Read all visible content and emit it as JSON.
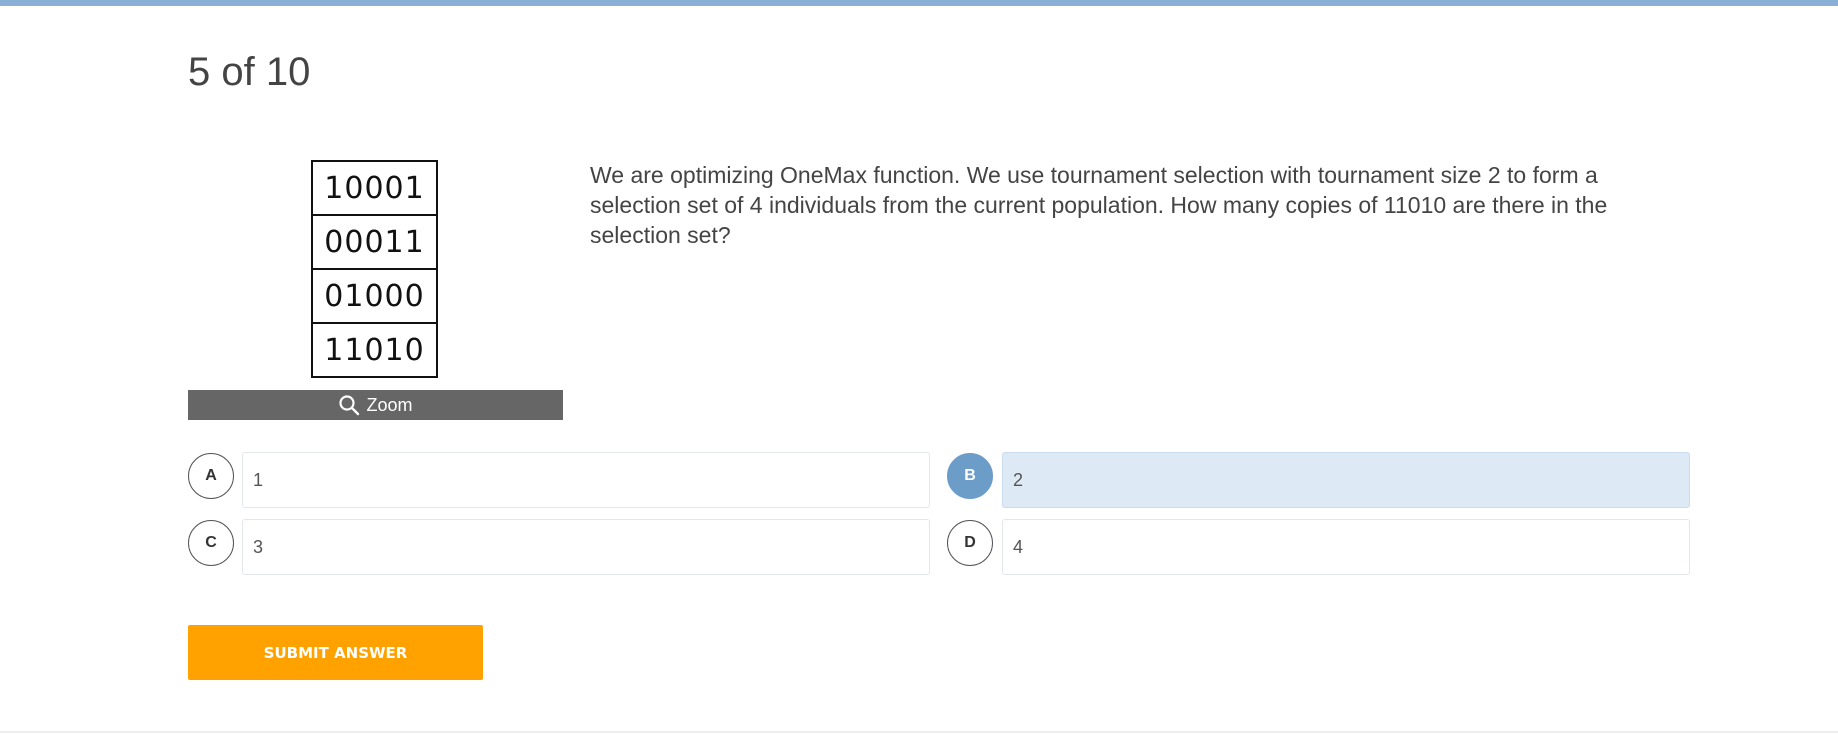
{
  "progress": {
    "current": "5",
    "of_label": "of",
    "total": "10",
    "text": "5 of 10"
  },
  "figure": {
    "population": [
      "10001",
      "00011",
      "01000",
      "11010"
    ],
    "zoom_label": "Zoom",
    "zoom_icon": "magnifier-icon"
  },
  "question": {
    "text": "We are optimizing OneMax function. We use tournament selection with tournament size 2 to form a selection set of 4 individuals from the current population. How many copies of 11010 are there in the selection set?"
  },
  "options": [
    {
      "letter": "A",
      "value": "1",
      "selected": false
    },
    {
      "letter": "B",
      "value": "2",
      "selected": true
    },
    {
      "letter": "C",
      "value": "3",
      "selected": false
    },
    {
      "letter": "D",
      "value": "4",
      "selected": false
    }
  ],
  "submit": {
    "label": "SUBMIT ANSWER"
  },
  "colors": {
    "top_bar": "#88afd6",
    "selected_circle": "#6c9dc9",
    "selected_box": "#dde9f4",
    "submit": "#ffa200",
    "zoom_bar": "#666666"
  }
}
